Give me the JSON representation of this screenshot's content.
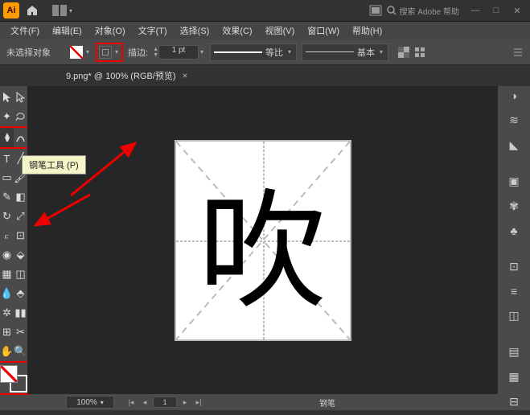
{
  "titlebar": {
    "app": "Ai",
    "search_ph": "搜索 Adobe 帮助"
  },
  "menus": [
    "文件(F)",
    "编辑(E)",
    "对象(O)",
    "文字(T)",
    "选择(S)",
    "效果(C)",
    "视图(V)",
    "窗口(W)",
    "帮助(H)"
  ],
  "ctrl": {
    "noselect": "未选择对象",
    "stroke_label": "描边:",
    "stroke_pt": "1 pt",
    "profile": "等比",
    "style": "基本"
  },
  "doc": {
    "name": "9.png* @ 100% (RGB/预览)"
  },
  "tooltip": "钢笔工具 (P)",
  "glyph": "吹",
  "status": {
    "zoom": "100%",
    "page": "1",
    "tool": "钢笔"
  }
}
